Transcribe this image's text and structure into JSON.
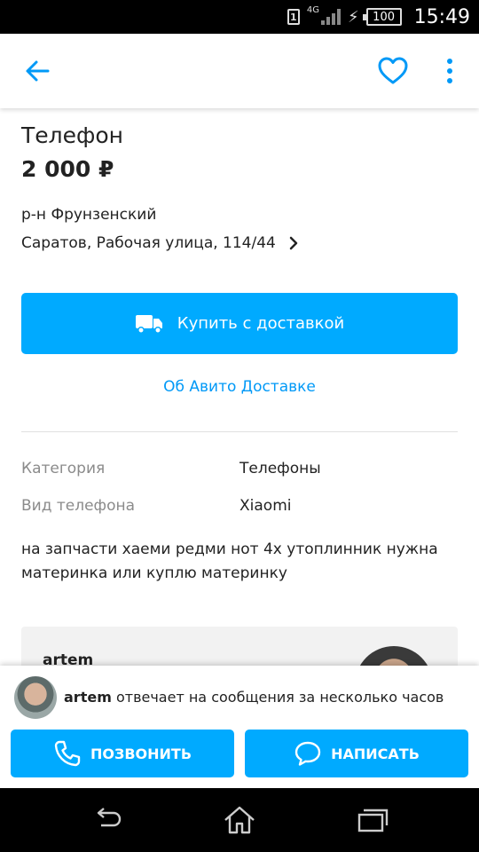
{
  "status_bar": {
    "sim_badge": "1",
    "network": "4G",
    "battery": "100",
    "time": "15:49"
  },
  "app_bar": {
    "back_icon": "arrow-left-icon",
    "favorite_icon": "heart-icon",
    "more_icon": "more-vertical-icon"
  },
  "listing": {
    "title": "Телефон",
    "price": "2 000 ₽",
    "district": "р-н Фрунзенский",
    "address": "Саратов, Рабочая улица, 114/44",
    "buy_button": "Купить с доставкой",
    "delivery_link": "Об Авито Доставке",
    "params": [
      {
        "label": "Категория",
        "value": "Телефоны"
      },
      {
        "label": "Вид телефона",
        "value": "Xiaomi"
      }
    ],
    "description": "на запчасти хаеми редми нот 4х утоплинник нужна материнка или куплю материнку"
  },
  "seller": {
    "name": "artem",
    "response_text": "отвечает на сообщения за несколько часов"
  },
  "actions": {
    "call_label": "ПОЗВОНИТЬ",
    "message_label": "НАПИСАТЬ"
  },
  "colors": {
    "accent": "#00aaff",
    "link": "#0099f7"
  }
}
